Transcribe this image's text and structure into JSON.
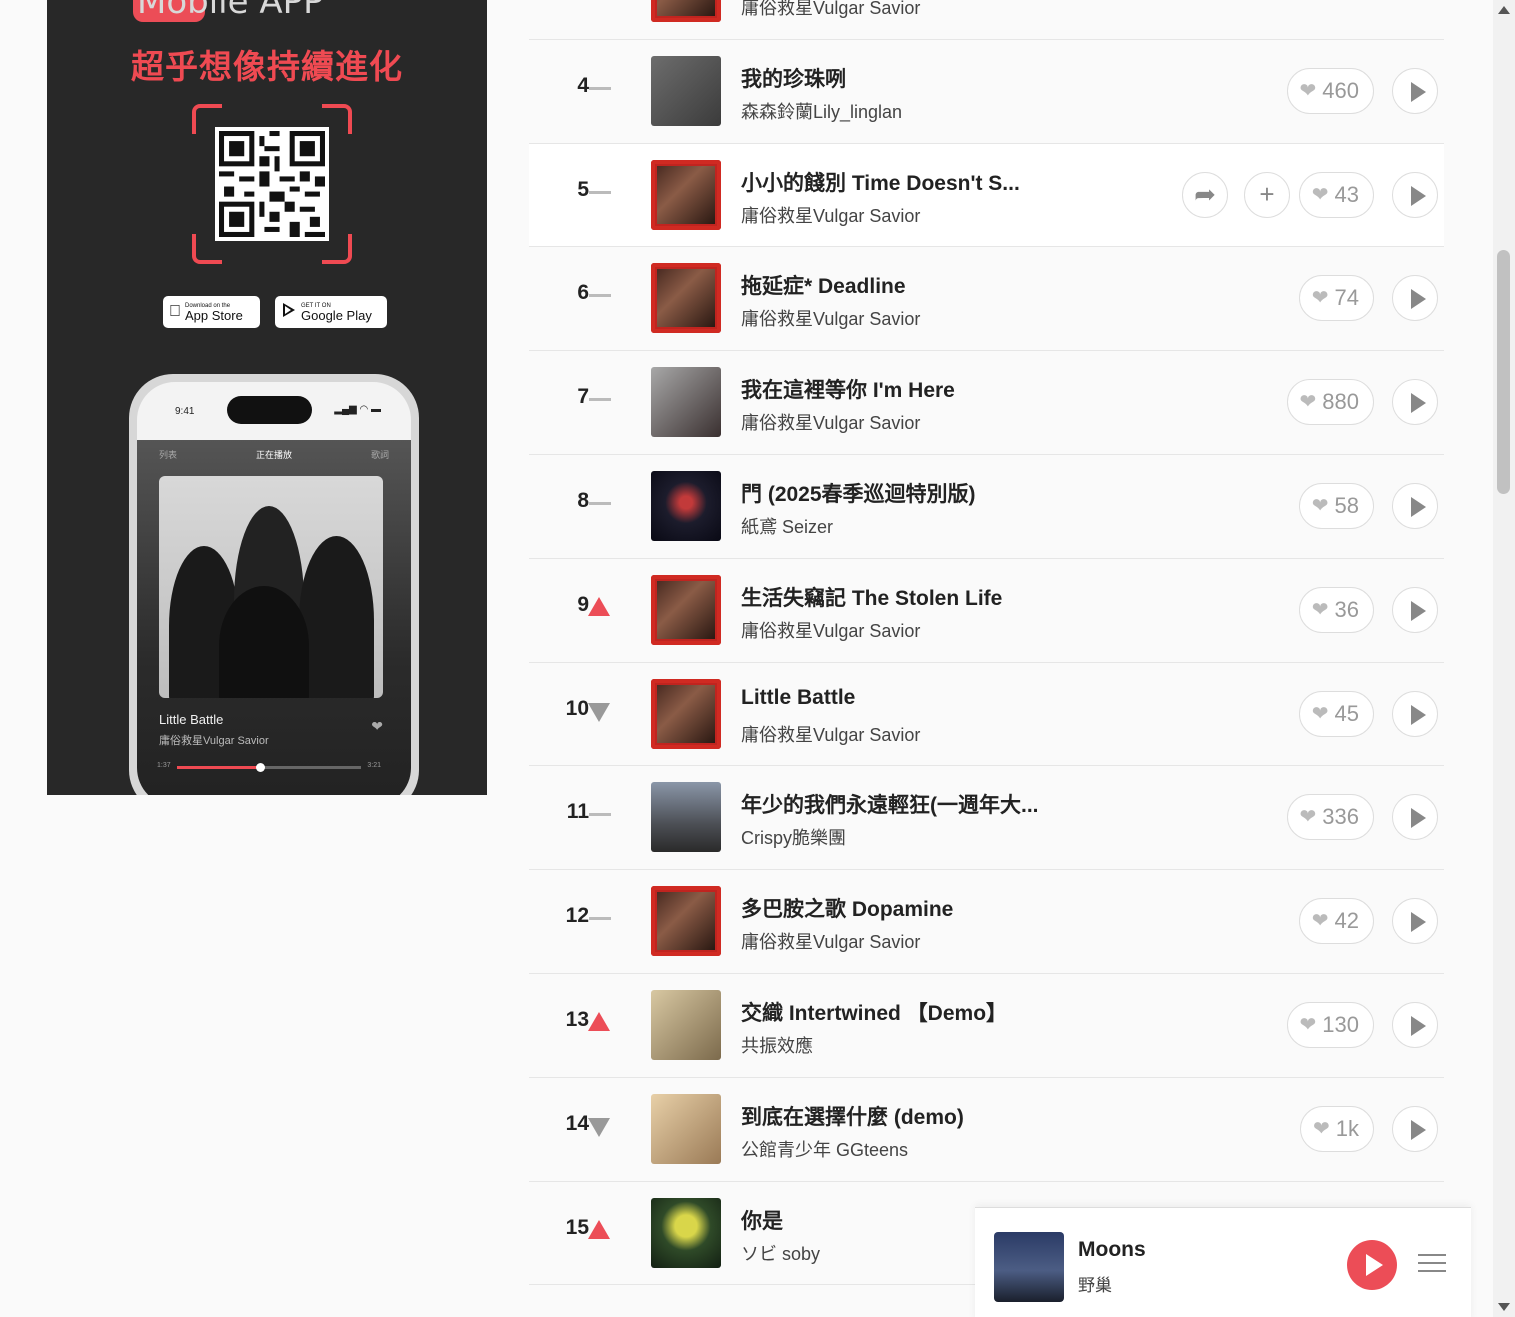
{
  "promo": {
    "app_title": "Mobile APP",
    "slogan": "超乎想像持續進化",
    "app_store": {
      "small": "Download on the",
      "big": "App Store"
    },
    "google_play": {
      "small": "GET IT ON",
      "big": "Google Play"
    },
    "phone": {
      "time": "9:41",
      "tabs": [
        "列表",
        "正在播放",
        "歌詞"
      ],
      "song": "Little Battle",
      "artist": "庸俗救星Vulgar Savior",
      "elapsed": "1:37",
      "duration": "3:21",
      "progress": 0.45
    }
  },
  "ranking": [
    {
      "rank": "",
      "trend": "",
      "cover": "red",
      "title": "",
      "artist": "庸俗救星Vulgar Savior",
      "likes": "",
      "partial": true
    },
    {
      "rank": "4",
      "trend": "same",
      "cover": "pearl",
      "title": "我的珍珠咧",
      "artist": "森森鈴蘭Lily_linglan",
      "likes": "460"
    },
    {
      "rank": "5",
      "trend": "same",
      "cover": "red",
      "title": "小小的餞別 Time Doesn't S...",
      "artist": "庸俗救星Vulgar Savior",
      "likes": "43",
      "hover": true
    },
    {
      "rank": "6",
      "trend": "same",
      "cover": "red",
      "title": "拖延症* Deadline",
      "artist": "庸俗救星Vulgar Savior",
      "likes": "74"
    },
    {
      "rank": "7",
      "trend": "same",
      "cover": "people",
      "title": "我在這裡等你 I'm Here",
      "artist": "庸俗救星Vulgar Savior",
      "likes": "880"
    },
    {
      "rank": "8",
      "trend": "same",
      "cover": "night",
      "title": "門 (2025春季巡迴特別版)",
      "artist": "紙鳶 Seizer",
      "likes": "58"
    },
    {
      "rank": "9",
      "trend": "up",
      "cover": "red",
      "title": "生活失竊記 The Stolen Life",
      "artist": "庸俗救星Vulgar Savior",
      "likes": "36"
    },
    {
      "rank": "10",
      "trend": "down",
      "cover": "red",
      "title": "Little Battle",
      "artist": "庸俗救星Vulgar Savior",
      "likes": "45"
    },
    {
      "rank": "11",
      "trend": "same",
      "cover": "sky",
      "title": "年少的我們永遠輕狂(一週年大...",
      "artist": "Crispy脆樂團",
      "likes": "336"
    },
    {
      "rank": "12",
      "trend": "same",
      "cover": "red",
      "title": "多巴胺之歌 Dopamine",
      "artist": "庸俗救星Vulgar Savior",
      "likes": "42"
    },
    {
      "rank": "13",
      "trend": "up",
      "cover": "cafe",
      "title": "交織 Intertwined 【Demo】",
      "artist": "共振效應",
      "likes": "130"
    },
    {
      "rank": "14",
      "trend": "down",
      "cover": "room",
      "title": "到底在選擇什麼 (demo)",
      "artist": "公館青少年 GGteens",
      "likes": "1k"
    },
    {
      "rank": "15",
      "trend": "up",
      "cover": "tree",
      "title": "你是",
      "artist": "ソビ soby",
      "likes": ""
    }
  ],
  "player": {
    "title": "Moons",
    "artist": "野巢"
  }
}
